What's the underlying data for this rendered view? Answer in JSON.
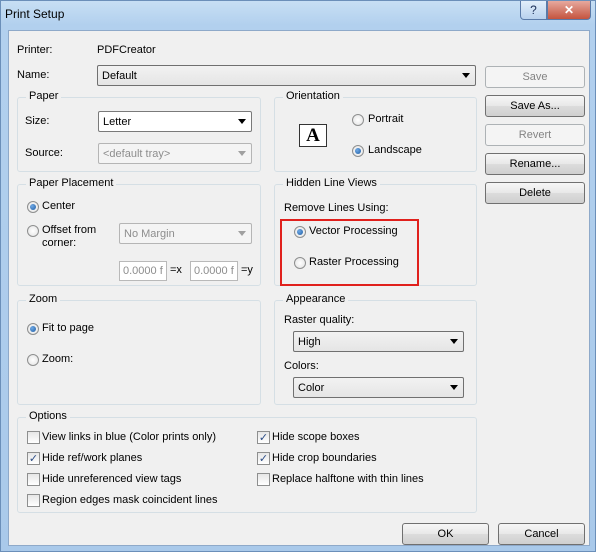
{
  "window": {
    "title": "Print Setup",
    "help_glyph": "?",
    "close_glyph": "✕"
  },
  "printer": {
    "label": "Printer:",
    "value": "PDFCreator"
  },
  "name": {
    "label": "Name:",
    "value": "Default"
  },
  "paper": {
    "title": "Paper",
    "size_label": "Size:",
    "size_value": "Letter",
    "source_label": "Source:",
    "source_value": "<default tray>"
  },
  "orientation": {
    "title": "Orientation",
    "icon_glyph": "A",
    "portrait": "Portrait",
    "landscape": "Landscape",
    "selected": "landscape"
  },
  "placement": {
    "title": "Paper Placement",
    "center": "Center",
    "offset_line1": "Offset from",
    "offset_line2": "corner:",
    "margin_value": "No Margin",
    "x_value": "0.0000 f",
    "x_suffix": "=x",
    "y_value": "0.0000 f",
    "y_suffix": "=y",
    "selected": "center"
  },
  "hidden_lines": {
    "title": "Hidden Line Views",
    "remove_label": "Remove Lines Using:",
    "vector": "Vector Processing",
    "raster": "Raster Processing",
    "selected": "vector"
  },
  "zoom": {
    "title": "Zoom",
    "fit": "Fit to page",
    "zoom": "Zoom:",
    "selected": "fit"
  },
  "appearance": {
    "title": "Appearance",
    "raster_label": "Raster quality:",
    "raster_value": "High",
    "colors_label": "Colors:",
    "colors_value": "Color"
  },
  "options": {
    "title": "Options",
    "view_links_blue": {
      "label": "View links in blue (Color prints only)",
      "checked": false
    },
    "hide_ref_planes": {
      "label": "Hide ref/work planes",
      "checked": true
    },
    "hide_unreferenced_tags": {
      "label": "Hide unreferenced view tags",
      "checked": false
    },
    "region_edges": {
      "label": "Region edges mask coincident lines",
      "checked": false
    },
    "hide_scope_boxes": {
      "label": "Hide scope boxes",
      "checked": true
    },
    "hide_crop_boundaries": {
      "label": "Hide crop boundaries",
      "checked": true
    },
    "replace_halftone": {
      "label": "Replace halftone with thin lines",
      "checked": false
    },
    "check_glyph": "✓"
  },
  "side_buttons": {
    "save": "Save",
    "save_as": "Save As...",
    "revert": "Revert",
    "rename": "Rename...",
    "delete": "Delete"
  },
  "footer": {
    "ok": "OK",
    "cancel": "Cancel"
  },
  "colors": {
    "highlight_border": "#e0201c",
    "accent_radio": "#1f5da4"
  }
}
